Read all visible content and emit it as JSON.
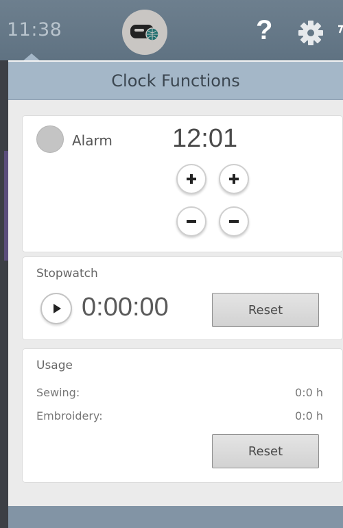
{
  "status_bar": {
    "time": "11:38",
    "icons": [
      "sewing-machine-icon",
      "help-icon",
      "gear-icon"
    ],
    "help_glyph": "?"
  },
  "panel": {
    "title": "Clock Functions"
  },
  "alarm": {
    "label": "Alarm",
    "time": "12:01",
    "enabled": false
  },
  "stopwatch": {
    "label": "Stopwatch",
    "time": "0:00:00",
    "reset_label": "Reset"
  },
  "usage": {
    "label": "Usage",
    "rows": [
      {
        "name": "Sewing:",
        "value": "0:0 h"
      },
      {
        "name": "Embroidery:",
        "value": "0:0 h"
      }
    ],
    "reset_label": "Reset"
  },
  "colors": {
    "header": "#a4b7c8",
    "topbar": "#647786",
    "footer": "#8294a5"
  }
}
